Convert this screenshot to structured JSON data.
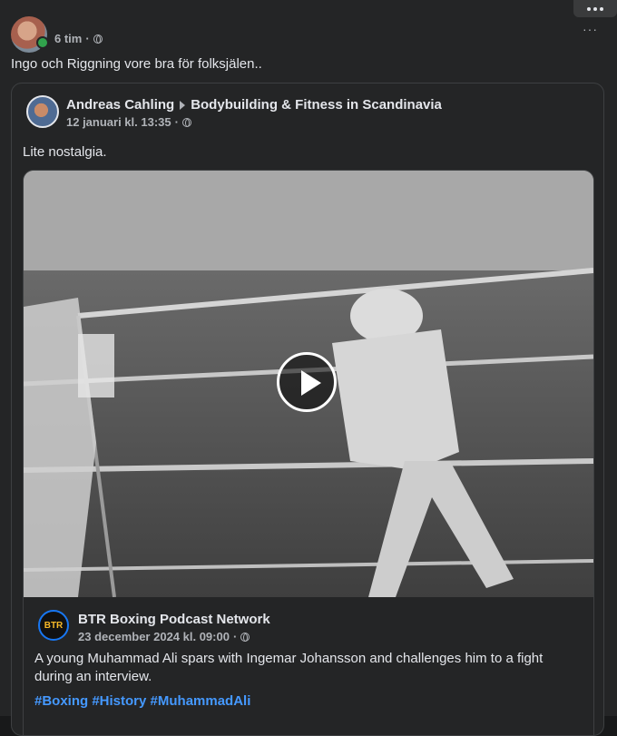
{
  "post": {
    "time": "6 tim",
    "separator": "·",
    "text": "Ingo och Riggning vore bra för folksjälen..",
    "more_label": "···"
  },
  "shared": {
    "author": "Andreas Cahling",
    "group": "Bodybuilding & Fitness in Scandinavia",
    "time": "12 januari kl. 13:35",
    "separator": "·",
    "text": "Lite nostalgia."
  },
  "inner": {
    "avatar_text": "BTR",
    "page_name": "BTR Boxing Podcast Network",
    "time": "23 december 2024 kl. 09:00",
    "separator": "·",
    "text": "A young Muhammad Ali spars with Ingemar Johansson and challenges him to a fight during an interview.",
    "hashtags": "#Boxing #History #MuhammadAli"
  },
  "icons": {
    "audience": "globe-icon",
    "play": "play-icon",
    "more": "more-icon"
  },
  "colors": {
    "background": "#18191a",
    "card": "#242526",
    "link": "#4599ff",
    "online": "#31a24c"
  }
}
